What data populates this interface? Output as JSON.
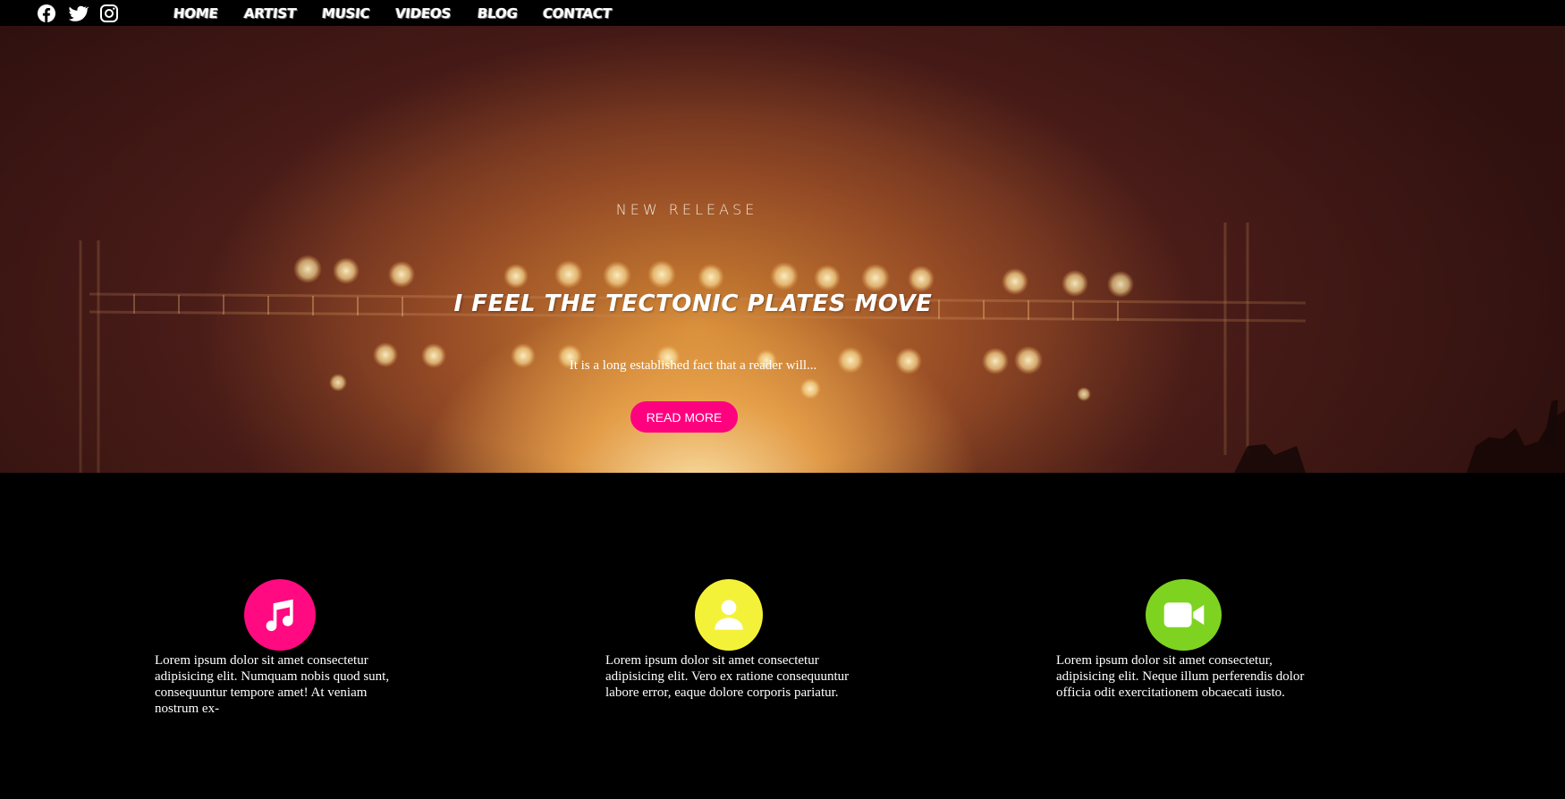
{
  "social": [
    {
      "name": "facebook-icon"
    },
    {
      "name": "twitter-icon"
    },
    {
      "name": "instagram-icon"
    }
  ],
  "nav": {
    "items": [
      "HOME",
      "ARTIST",
      "MUSIC",
      "VIDEOS",
      "BLOG",
      "CONTACT"
    ]
  },
  "hero": {
    "kicker": "NEW RELEASE",
    "title": "I FEEL THE TECTONIC PLATES MOVE",
    "text": "It is a long established fact that a reader will...",
    "button_label": "READ MORE"
  },
  "features": [
    {
      "icon": "music-note-icon",
      "color": "#ff0a80",
      "text": "Lorem ipsum dolor sit amet consectetur adipisicing elit. Numquam nobis quod sunt, consequuntur tempore amet! At veniam nostrum ex-"
    },
    {
      "icon": "user-icon",
      "color": "#f4f238",
      "text": "Lorem ipsum dolor sit amet consectetur adipisicing elit. Vero ex ratione consequuntur labore error, eaque dolore corporis pariatur."
    },
    {
      "icon": "video-camera-icon",
      "color": "#7ed321",
      "text": "Lorem ipsum dolor sit amet consectetur, adipisicing elit. Neque illum perferendis dolor officia odit exercitationem obcaecati iusto."
    }
  ]
}
